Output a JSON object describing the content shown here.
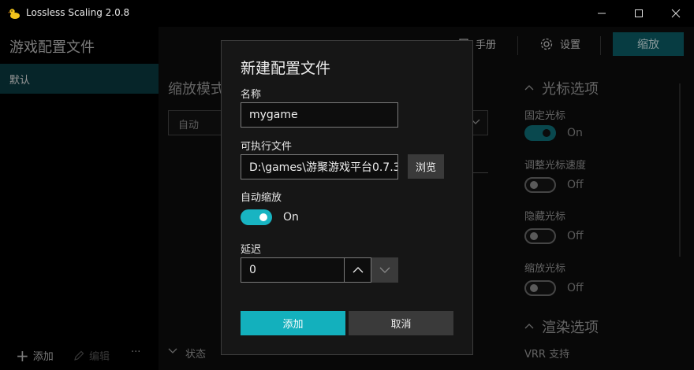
{
  "window": {
    "title": "Lossless Scaling 2.0.8",
    "minimize": "—",
    "maximize": "☐",
    "close": "✕"
  },
  "sidebar": {
    "heading": "游戏配置文件",
    "items": [
      {
        "label": "默认",
        "selected": true
      }
    ],
    "add_label": "添加",
    "edit_label": "编辑",
    "more_label": "···"
  },
  "toolbar": {
    "manual_label": "手册",
    "settings_label": "设置",
    "scale_button": "缩放"
  },
  "main": {
    "mode_heading": "缩放模式",
    "mode_value": "自动",
    "status_label": "状态"
  },
  "options": {
    "cursor_section": "光标选项",
    "cursor_items": [
      {
        "label": "固定光标",
        "state": "On",
        "on": true
      },
      {
        "label": "调整光标速度",
        "state": "Off",
        "on": false
      },
      {
        "label": "隐藏光标",
        "state": "Off",
        "on": false
      },
      {
        "label": "缩放光标",
        "state": "Off",
        "on": false
      }
    ],
    "render_section": "渲染选项",
    "vrr_label": "VRR 支持"
  },
  "dialog": {
    "title": "新建配置文件",
    "name_label": "名称",
    "name_value": "mygame",
    "exe_label": "可执行文件",
    "exe_value": "D:\\games\\游聚游戏平台0.7.3",
    "browse_label": "浏览",
    "autoscale_label": "自动缩放",
    "autoscale_state": "On",
    "delay_label": "延迟",
    "delay_value": "0",
    "add_button": "添加",
    "cancel_button": "取消"
  },
  "colors": {
    "accent": "#13b0bd",
    "accent_dark": "#0b5d66",
    "selection": "#0a3a3f"
  }
}
